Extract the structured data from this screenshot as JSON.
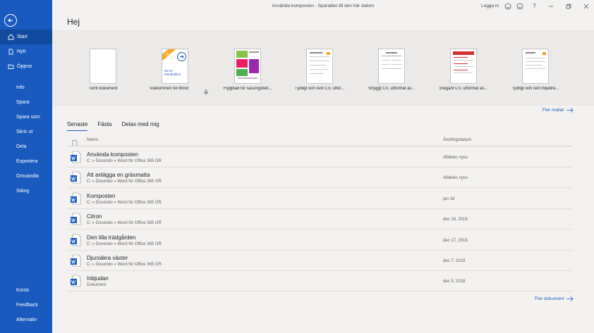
{
  "titlebar": {
    "title": "Använda komposten  -  Sparades till den här datorn",
    "login": "Logga in",
    "help": "?"
  },
  "sidebar": {
    "items_top": [
      {
        "label": "Start",
        "icon": "home-icon"
      },
      {
        "label": "Nytt",
        "icon": "new-document-icon"
      },
      {
        "label": "Öppna",
        "icon": "folder-icon"
      }
    ],
    "items_mid": [
      "Info",
      "Spara",
      "Spara som",
      "Skriv ut",
      "Dela",
      "Exportera",
      "Omvandla",
      "Stäng"
    ],
    "items_bottom": [
      "Konto",
      "Feedback",
      "Alternativ"
    ]
  },
  "greeting": "Hej",
  "templates": [
    {
      "label": "Tomt dokument"
    },
    {
      "label": "Välkommen till Word",
      "badge": "Nytt",
      "thumb_text": "Se en introduktion"
    },
    {
      "label": "Flygblad för säsongsbet..."
    },
    {
      "label": "Tydligt och rent CV, utfor..."
    },
    {
      "label": "Snyggt CV, utformat av..."
    },
    {
      "label": "Elegant CV, utformat av..."
    },
    {
      "label": "Tydligt och rent följebre..."
    }
  ],
  "more_templates": "Fler mallar",
  "tabs": [
    "Senaste",
    "Fästa",
    "Delas med mig"
  ],
  "columns": {
    "name": "Namn",
    "date": "Ändringsdatum"
  },
  "documents": [
    {
      "name": "Använda komposten",
      "path": "C: » Docendo » Word för Office 365 GR",
      "date": "Alldeles nyss"
    },
    {
      "name": "Att anlägga en gräsmatta",
      "path": "C: » Docendo » Word för Office 365 GR",
      "date": "Alldeles nyss"
    },
    {
      "name": "Komposten",
      "path": "C: » Docendo » Word för Office 365 GR",
      "date": "jan 18"
    },
    {
      "name": "Citron",
      "path": "C: » Docendo » Word för Office 365 GR",
      "date": "dec 18, 2018"
    },
    {
      "name": "Den lilla trädgården",
      "path": "C: » Docendo » Word för Office 365 GR",
      "date": "dec 17, 2018"
    },
    {
      "name": "Djursäkra växter",
      "path": "C: » Docendo » Word för Office 365 GR",
      "date": "dec 7, 2018"
    },
    {
      "name": "Inbjudan",
      "path": "Dokument",
      "date": "dec 5, 2018"
    }
  ],
  "more_documents": "Fler dokument",
  "colors": {
    "accent": "#185abd",
    "sidebar_active": "#124a9e"
  }
}
